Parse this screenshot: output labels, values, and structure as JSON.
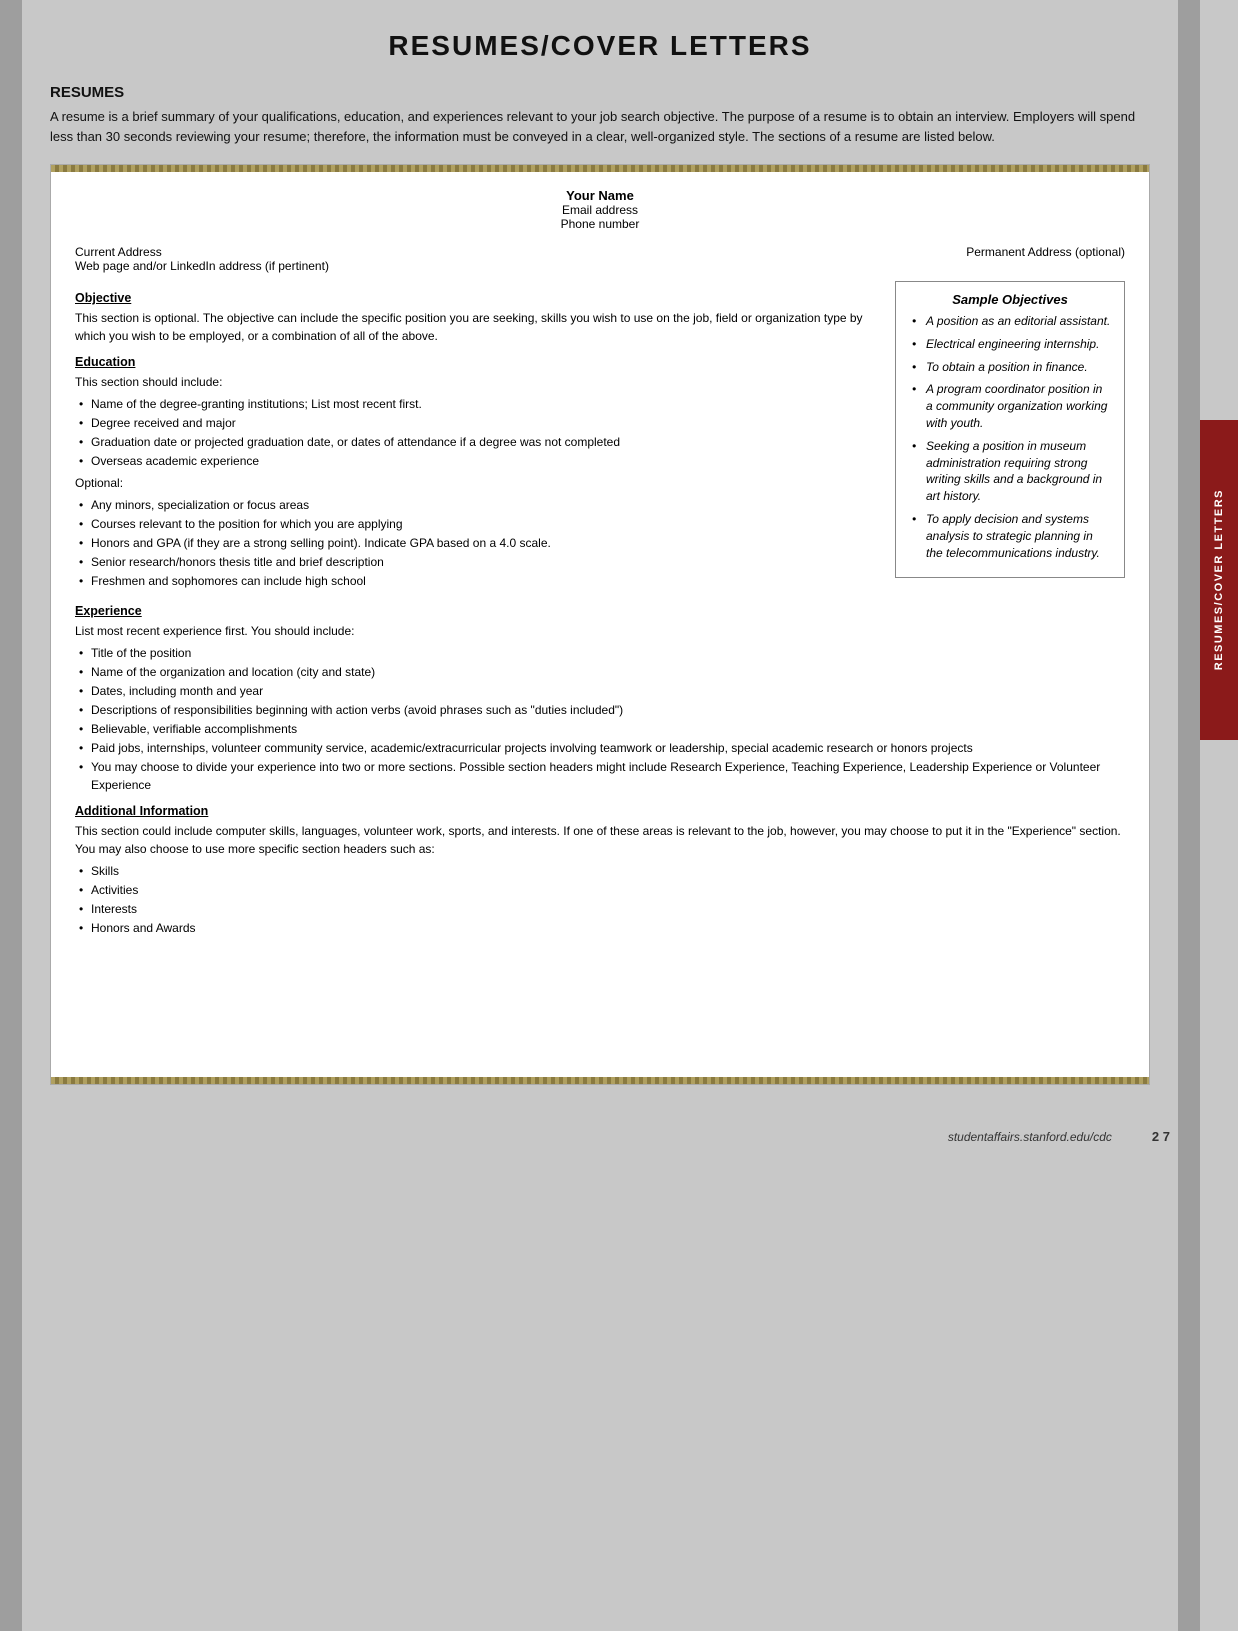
{
  "page": {
    "title": "RESUMES/COVER LETTERS",
    "footer_url": "studentaffairs.stanford.edu/cdc",
    "footer_page": "2  7"
  },
  "resumes_section": {
    "heading": "RESUMES",
    "intro": "A resume is a brief summary of your qualifications, education, and experiences relevant to your job search objective. The purpose of a resume is to obtain an interview. Employers will spend less than 30 seconds reviewing your resume; therefore, the information must be conveyed in a clear, well-organized style. The sections of a resume are listed below."
  },
  "resume_template": {
    "name": "Your Name",
    "email": "Email address",
    "phone": "Phone number",
    "current_address": "Current Address",
    "web_address": "Web page and/or LinkedIn address (if pertinent)",
    "permanent_address": "Permanent Address (optional)"
  },
  "objective_section": {
    "title": "Objective",
    "body": "This section is optional. The objective can include the specific position you are seeking, skills you wish to use on the job, field or organization type by which you wish to be employed, or a combination of all of the above."
  },
  "sample_objectives": {
    "title": "Sample Objectives",
    "items": [
      "A position as an editorial assistant.",
      "Electrical engineering internship.",
      "To obtain a position in finance.",
      "A program coordinator position in a community organization working with youth.",
      "Seeking a position in museum administration requiring strong writing skills and a background in art history.",
      "To apply decision and systems analysis to strategic planning in the telecommunications industry."
    ]
  },
  "education_section": {
    "title": "Education",
    "intro": "This section should include:",
    "required_items": [
      "Name of the degree-granting institutions; List most recent first.",
      "Degree received and major",
      "Graduation date or projected graduation date, or dates of attendance if a degree was not completed",
      "Overseas academic experience"
    ],
    "optional_label": "Optional:",
    "optional_items": [
      "Any minors, specialization or focus areas",
      "Courses relevant to the position for which you are applying",
      "Honors and GPA (if they are a strong selling point). Indicate GPA based on a 4.0 scale.",
      "Senior research/honors thesis title and brief description",
      "Freshmen and sophomores can include high school"
    ]
  },
  "experience_section": {
    "title": "Experience",
    "intro": "List most recent experience first. You should include:",
    "items": [
      "Title of the position",
      "Name of the organization and location (city and state)",
      "Dates, including month and year",
      "Descriptions of responsibilities beginning with action verbs (avoid phrases such as \"duties included\")",
      "Believable, verifiable accomplishments",
      "Paid jobs, internships, volunteer community service, academic/extracurricular projects involving teamwork or leadership, special academic research or honors projects",
      "You may choose to divide your experience into two or more sections. Possible section headers might include Research Experience, Teaching Experience, Leadership Experience or Volunteer Experience"
    ]
  },
  "additional_section": {
    "title": "Additional Information",
    "intro": "This section could include computer skills, languages, volunteer work, sports, and interests. If one of these areas is relevant to the job, however, you may choose to put it in the \"Experience\" section. You may also choose to use more specific section headers such as:",
    "items": [
      "Skills",
      "Activities",
      "Interests",
      "Honors and Awards"
    ]
  },
  "side_tab": {
    "label": "RESUMES/COVER LETTERS"
  }
}
